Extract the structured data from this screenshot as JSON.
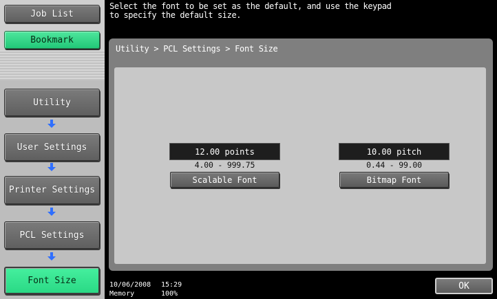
{
  "nav": {
    "job_list": "Job List",
    "bookmark": "Bookmark",
    "utility": "Utility",
    "user_settings": "User Settings",
    "printer_settings": "Printer Settings",
    "pcl_settings": "PCL Settings",
    "font_size": "Font Size"
  },
  "message": "Select the font to be set as the default, and use the keypad\nto specify the default size.",
  "breadcrumb": "Utility > PCL Settings > Font Size",
  "scalable": {
    "value": "12.00 points",
    "range": "4.00  -  999.75",
    "button": "Scalable Font"
  },
  "bitmap": {
    "value": "10.00  pitch",
    "range": "0.44  -  99.00",
    "button": "Bitmap Font"
  },
  "status": {
    "date": "10/06/2008",
    "time": "15:29",
    "memory_label": "Memory",
    "memory_value": "100%"
  },
  "ok_button": "OK",
  "colors": {
    "arrow_blue": "#2f6fff",
    "green_button": "#2ad985",
    "panel_gray": "#7f7f7f"
  },
  "icons": [
    "down-arrow-icon"
  ]
}
